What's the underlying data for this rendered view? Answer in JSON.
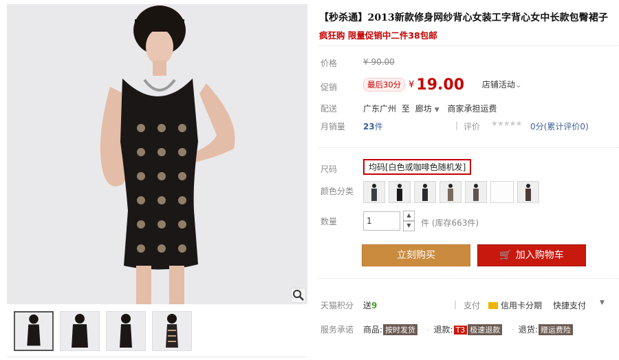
{
  "title": "【秒杀通】2013新款修身网纱背心女装工字背心女中长款包臀裙子",
  "subtitle": "疯狂购 限量促销中二件38包邮",
  "price": {
    "label": "价格",
    "original": "¥ 90.00"
  },
  "promo": {
    "label": "促销",
    "badge": "最后30分",
    "yen": "¥",
    "value": "19.00",
    "store_activity": "店铺活动"
  },
  "shipping": {
    "label": "配送",
    "from": "广东广州",
    "to_word": "至",
    "to": "廊坊",
    "fee": "商家承担运费"
  },
  "sales": {
    "label": "月销量",
    "count": "23",
    "unit": "件",
    "rating_label": "评价",
    "rating_text": "0分(累计评价0)",
    "stars": "★★★★★"
  },
  "size": {
    "label": "尺码",
    "value": "均码[白色或咖啡色随机发]"
  },
  "color": {
    "label": "颜色分类"
  },
  "quantity": {
    "label": "数量",
    "value": "1",
    "unit": "件",
    "stock": "(库存663件)"
  },
  "buttons": {
    "buy": "立刻购买",
    "cart": "加入购物车"
  },
  "points": {
    "label": "天猫积分",
    "prefix": "送",
    "value": "9",
    "pay_label": "支付",
    "card": "信用卡分期",
    "quick": "快捷支付"
  },
  "service": {
    "label": "服务承诺",
    "goods": "商品:",
    "goods_tag": "按时发货",
    "refund": "退款:",
    "refund_tag1": "T3",
    "refund_tag2": "极速退款",
    "return": "退货:",
    "return_tag": "赠运费险"
  },
  "colors": {
    "accent": "#c40000",
    "buy": "#cb8b3f",
    "cart": "#c8190e"
  }
}
